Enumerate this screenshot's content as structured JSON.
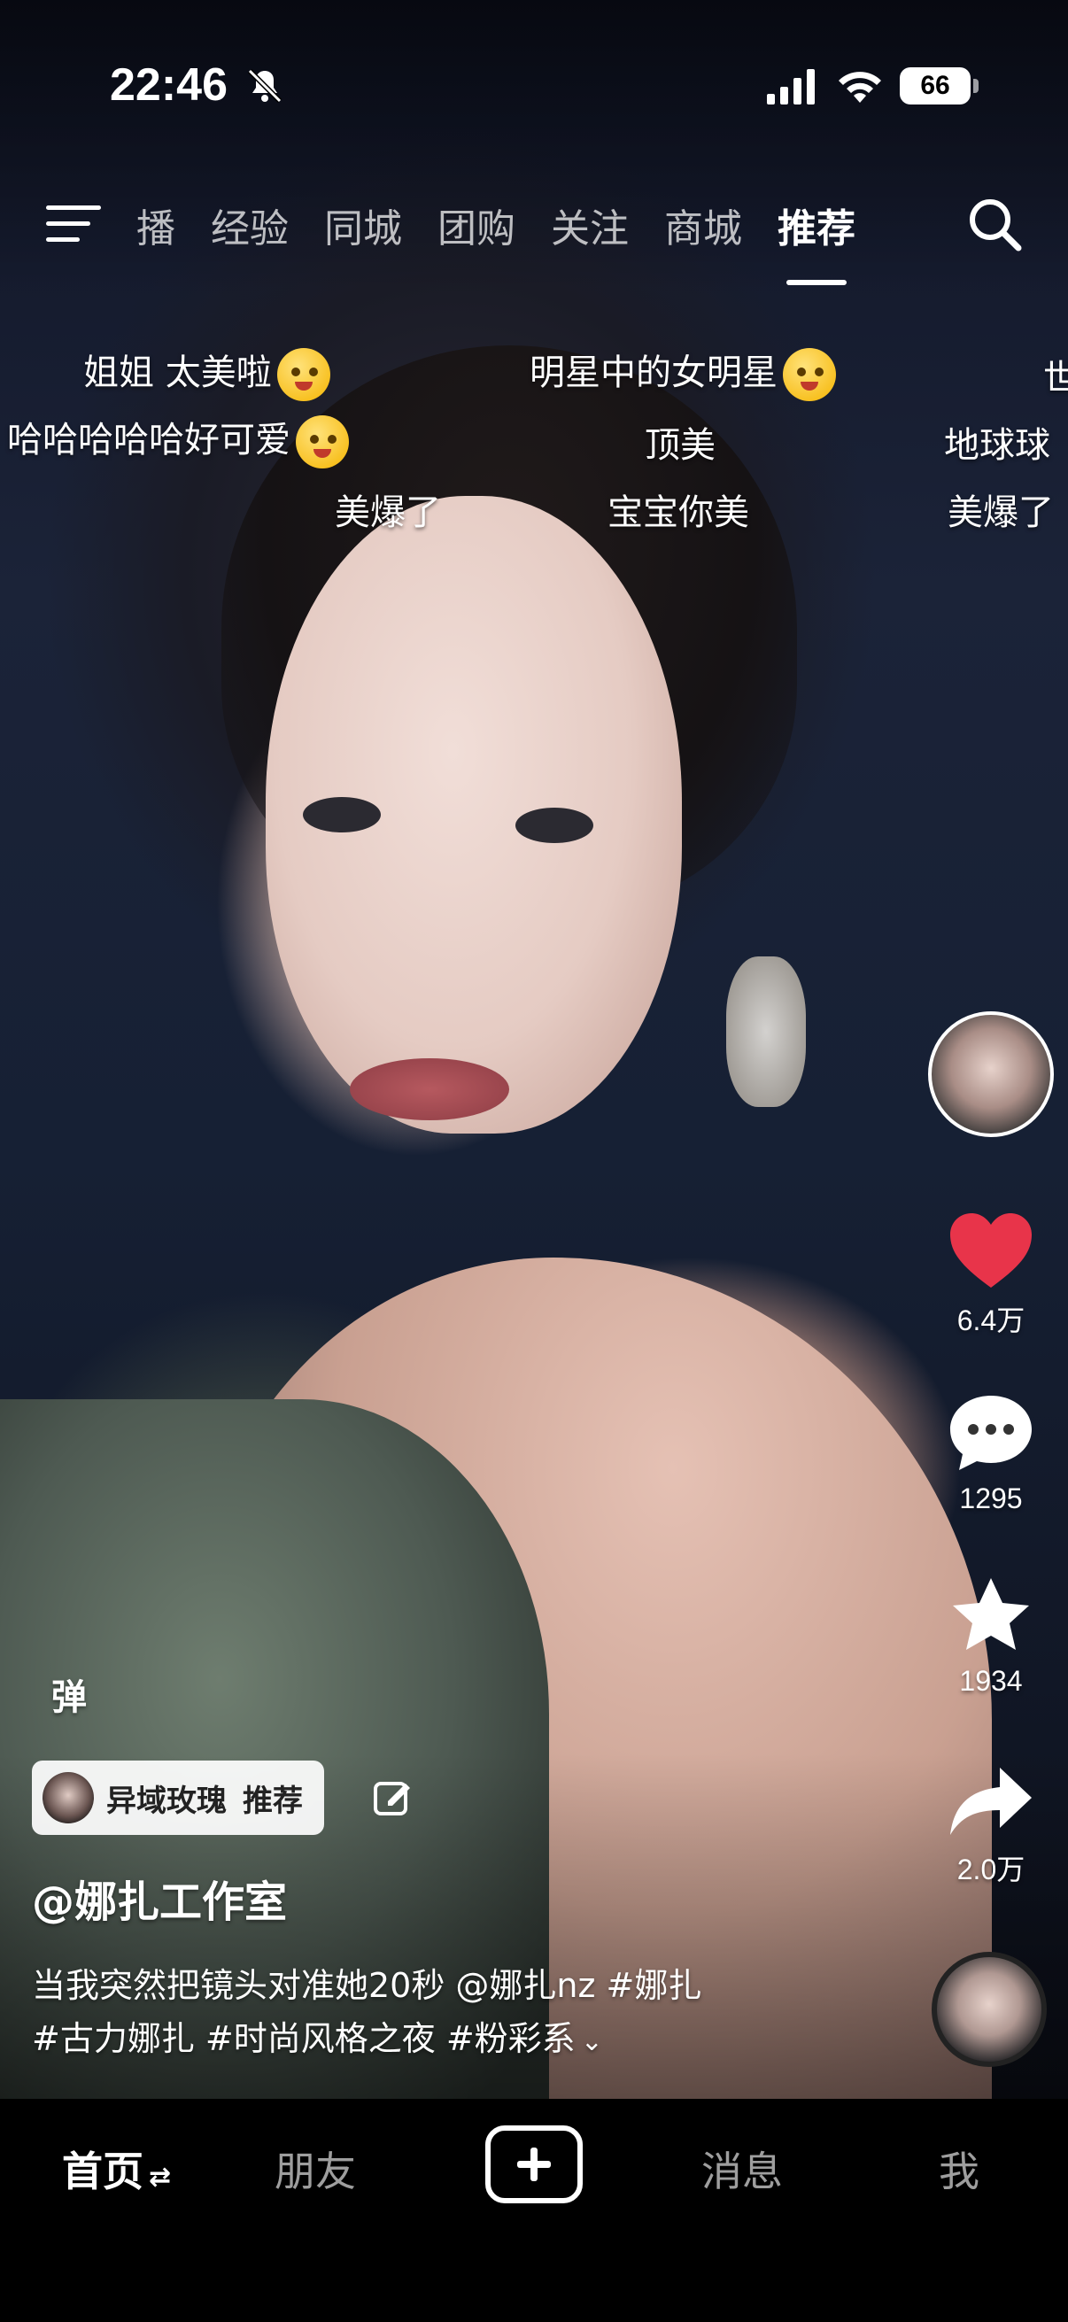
{
  "status_bar": {
    "time": "22:46",
    "battery": "66",
    "icons": [
      "bell-slash-icon",
      "cellular-signal-icon",
      "wifi-icon",
      "battery-icon"
    ]
  },
  "top_nav": {
    "tabs": [
      "播",
      "经验",
      "同城",
      "团购",
      "关注",
      "商城",
      "推荐"
    ],
    "active_tab": "推荐",
    "icons": [
      "menu-icon",
      "search-icon"
    ]
  },
  "danmaku": [
    {
      "text": "姐姐 太美啦",
      "emoji": "crying-face-emoji"
    },
    {
      "text": "明星中的女明星",
      "emoji": "hearts-face-emoji"
    },
    {
      "text": "世"
    },
    {
      "text": "哈哈哈哈哈好可爱",
      "emoji": "kissing-face-emoji"
    },
    {
      "text": "顶美"
    },
    {
      "text": "地球球"
    },
    {
      "text": "美爆了"
    },
    {
      "text": "宝宝你美"
    },
    {
      "text": "美爆了"
    }
  ],
  "right_rail": {
    "like_count": "6.4万",
    "comment_count": "1295",
    "favorite_count": "1934",
    "share_count": "2.0万",
    "like_color": "#e8344a"
  },
  "video_info": {
    "danmaku_toggle": "弹",
    "tag_pill": {
      "name": "异域玫瑰",
      "action": "推荐"
    },
    "author": "@娜扎工作室",
    "description_line1": "当我突然把镜头对准她20秒 @娜扎nz #娜扎",
    "description_line2": "#古力娜扎 #时尚风格之夜 #粉彩系",
    "expand_icon": "chevron-down-icon"
  },
  "bottom_nav": {
    "home": "首页",
    "friends": "朋友",
    "messages": "消息",
    "me": "我",
    "home_switch_icon": "⇄"
  }
}
